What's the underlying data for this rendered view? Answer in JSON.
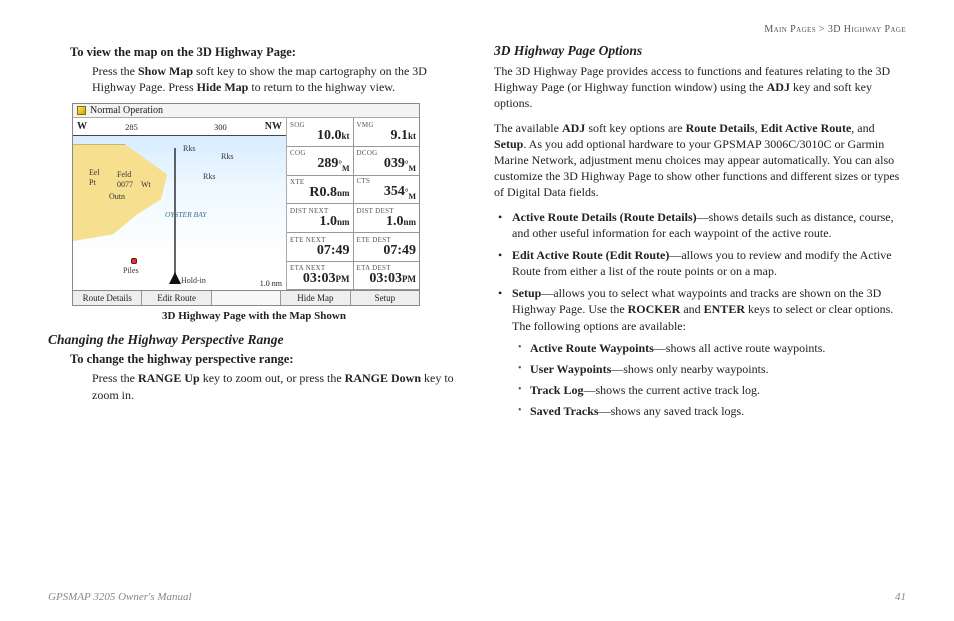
{
  "breadcrumb": {
    "left": "Main Pages",
    "sep": ">",
    "right": "3D Highway Page"
  },
  "left_col": {
    "view_map_heading": "To view the map on the 3D Highway Page:",
    "view_map_body_parts": [
      "Press the ",
      "Show Map",
      " soft key to show the map cartography on the 3D Highway Page. Press ",
      "Hide Map",
      " to return to the highway view."
    ],
    "figure_caption": "3D Highway Page with the Map Shown",
    "persp_heading": "Changing the Highway Perspective Range",
    "persp_sub": "To change the highway perspective range:",
    "persp_body_parts": [
      "Press the ",
      "RANGE Up",
      " key to zoom out, or press the ",
      "RANGE Down",
      " key to zoom in."
    ]
  },
  "device": {
    "title": "Normal Operation",
    "compass": {
      "left_dir": "W",
      "ticks": [
        "285",
        "300"
      ],
      "right_dir": "NW"
    },
    "water_label": "OYSTER BAY",
    "points": [
      "Rks",
      "Rks",
      "Rks",
      "Eel",
      "Pt",
      "Feld",
      "0077",
      "Outn",
      "Wt",
      "Piles",
      "Hold-in"
    ],
    "scale": "1.0 nm",
    "cells": [
      {
        "label": "SOG",
        "value": "10.0",
        "unit": "kt"
      },
      {
        "label": "VMG",
        "value": "9.1",
        "unit": "kt"
      },
      {
        "label": "COG",
        "value": "289",
        "unit": "°",
        "sub": "M"
      },
      {
        "label": "DCOG",
        "value": "039",
        "unit": "°",
        "sub": "M"
      },
      {
        "label": "XTE",
        "value": "R0.8",
        "unit": "nm"
      },
      {
        "label": "CTS",
        "value": "354",
        "unit": "°",
        "sub": "M"
      },
      {
        "label": "DIST NEXT",
        "value": "1.0",
        "unit": "nm"
      },
      {
        "label": "DIST DEST",
        "value": "1.0",
        "unit": "nm"
      },
      {
        "label": "ETE NEXT",
        "value": "07:49",
        "unit": ""
      },
      {
        "label": "ETE DEST",
        "value": "07:49",
        "unit": ""
      },
      {
        "label": "ETA NEXT",
        "value": "03:03",
        "unit": "PM"
      },
      {
        "label": "ETA DEST",
        "value": "03:03",
        "unit": "PM"
      }
    ],
    "softkeys": [
      "Route Details",
      "Edit Route",
      "",
      "Hide Map",
      "Setup"
    ]
  },
  "right_col": {
    "heading": "3D Highway Page Options",
    "para1_parts": [
      "The 3D Highway Page provides access to functions and features relating to the 3D Highway Page (or Highway function window) using the ",
      "ADJ",
      " key and soft key options."
    ],
    "para2_parts": [
      "The available ",
      "ADJ",
      " soft key options are ",
      "Route Details",
      ", ",
      "Edit Active Route",
      ", and ",
      "Setup",
      ". As you add optional hardware to your GPSMAP 3006C/3010C or Garmin Marine Network, adjustment menu choices may appear automatically. You can also customize the 3D Highway Page to show other functions and different sizes or types of Digital Data fields."
    ],
    "bullets": [
      {
        "bold": "Active Route Details (Route Details)",
        "rest": "—shows details such as distance, course, and other useful information for each waypoint of the active route."
      },
      {
        "bold": "Edit Active Route (Edit Route)",
        "rest": "—allows you to review and modify the Active Route from either a list of the route points or on a map."
      }
    ],
    "setup_intro_parts": [
      "Setup",
      "—allows you to select what waypoints and tracks are shown on the 3D Highway Page. Use the ",
      "ROCKER",
      " and ",
      "ENTER",
      " keys to select or clear options. The following options are available:"
    ],
    "sub_bullets": [
      {
        "bold": "Active Route Waypoints",
        "rest": "—shows all active route waypoints."
      },
      {
        "bold": "User Waypoints",
        "rest": "—shows only nearby waypoints."
      },
      {
        "bold": "Track Log",
        "rest": "—shows the current active track log."
      },
      {
        "bold": "Saved Tracks",
        "rest": "—shows any saved track logs."
      }
    ]
  },
  "footer": {
    "left": "GPSMAP 3205 Owner's Manual",
    "right": "41"
  }
}
